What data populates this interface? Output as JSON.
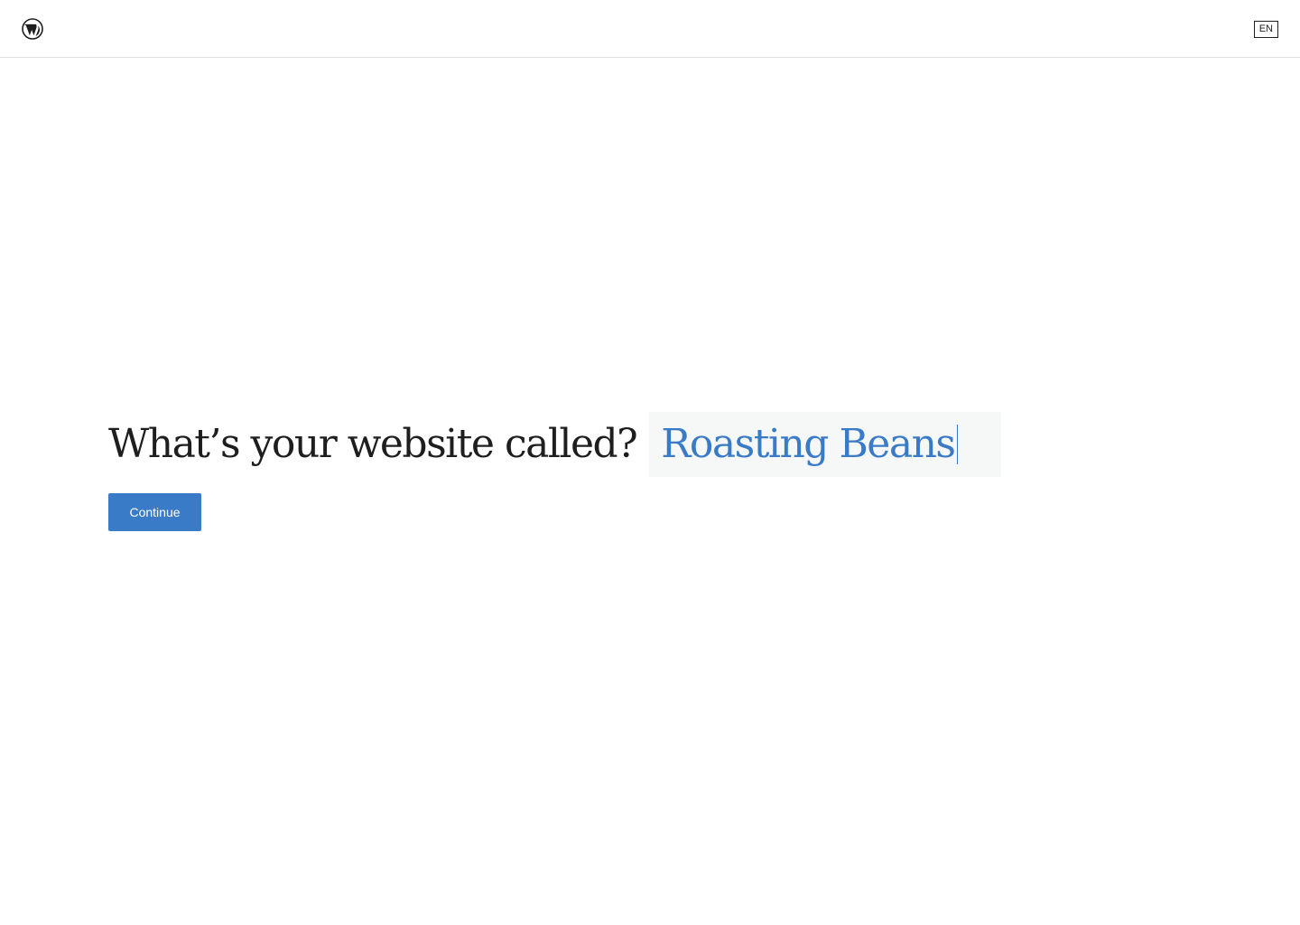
{
  "header": {
    "logo_icon": "wordpress-logo-icon",
    "language_label": "EN"
  },
  "main": {
    "question": "What’s your website called?",
    "site_name_value": "Roasting Beans",
    "continue_label": "Continue"
  },
  "colors": {
    "accent": "#3a7bc8",
    "text": "#1e1e1e",
    "input_background": "#f6f7f7",
    "border": "#e0e0e0"
  }
}
